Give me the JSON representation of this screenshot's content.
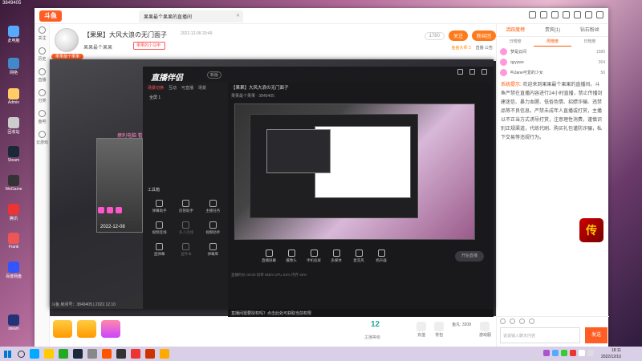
{
  "desktop": {
    "corner_label": "3849405",
    "icons": [
      {
        "label": "此电脑"
      },
      {
        "label": "网络"
      },
      {
        "label": "Admin"
      },
      {
        "label": "回收站"
      },
      {
        "label": "Steam"
      },
      {
        "label": "WeGame"
      },
      {
        "label": "腾讯"
      },
      {
        "label": "Frank"
      },
      {
        "label": "百度网盘"
      },
      {
        "label": "steam"
      }
    ]
  },
  "app": {
    "logo": "斗鱼",
    "tab_title": "果果最个果果的直播间",
    "nav": [
      "关注",
      "历史",
      "直播",
      "分类",
      "鱼吧",
      "云游戏"
    ],
    "room": {
      "title": "【果果】大风大浪の无门面子",
      "time": "2022-12-09 20:49",
      "anchor": "果果最个果果",
      "tag": "果果的小马甲",
      "avatar_label": "果果最个果果",
      "count": "1780",
      "follow": "关注",
      "fans": "粉丝团",
      "row2_a": "鱼鱼大师 3",
      "row2_b": "直播 公告"
    },
    "chat": {
      "tabs": [
        "活跃度榜",
        "贵宾(1)",
        "钻石粉丝"
      ],
      "subtabs": [
        "日榜度",
        "周榜度",
        "日榜度"
      ],
      "ranks": [
        {
          "name": "梦是云间",
          "value": "1580"
        },
        {
          "name": "qyyywo",
          "value": "264"
        },
        {
          "name": "叫Jane可爱的少女",
          "value": "56"
        }
      ],
      "system_label": "系统提示:",
      "message": "欢迎来到果果最个果果的直播间。斗鱼严禁在直播内容进行24小时直播，禁止传播封建迷信、暴力血腥、低俗色情、招嫖诈骗、违禁品等不良信息。严禁未成年人直播或打赏，主播以不正当方式诱导打赏，注意理性消费，谨慎识别正规渠道，代练代刷、购买礼包谨防诈骗，私下交易等违规行为。",
      "input_placeholder": "说说输入聊天内容",
      "send": "发送"
    },
    "bottom": {
      "badge_count": "12",
      "badge_label": "主播等级",
      "items": [
        "充值",
        "背包",
        "鱼丸: 3208",
        "游戏服"
      ]
    }
  },
  "capture": {
    "title": "直播伴侣",
    "version": "新版",
    "left_tabs": [
      "场景切换",
      "互动",
      "可直播",
      "场景"
    ],
    "scene": "全屏 1",
    "tools_title": "工具箱",
    "tools": [
      "弹幕助手",
      "房管助手",
      "主播任务",
      "视频连线",
      "多人连线",
      "视频助手",
      "直弹幕",
      "盗件本",
      "弹幕库"
    ],
    "right_title": "【果果】大风大浪の无门面子",
    "right_sub": "果果最个果果 · 3849405",
    "ctrls": [
      "直播屏幕",
      "摄像头",
      "手机投屏",
      "多媒体",
      "麦克风",
      "扬声器"
    ],
    "start": "开始直播",
    "stat": "直播时长 00:00  码率 0kb/s  CPU 24%  内存 40%",
    "notice": "直播间需要授权吗？点击此处可获取当前权限",
    "bottom_text": "斗鱼 房间号：3849405 | 2022.12.10",
    "thumb_text": "撩利电脑 看一波——",
    "thumb_date": "2022-12-08"
  },
  "taskbar": {
    "time": "18:11",
    "date": "2022/12/10"
  },
  "game_icon": "传"
}
